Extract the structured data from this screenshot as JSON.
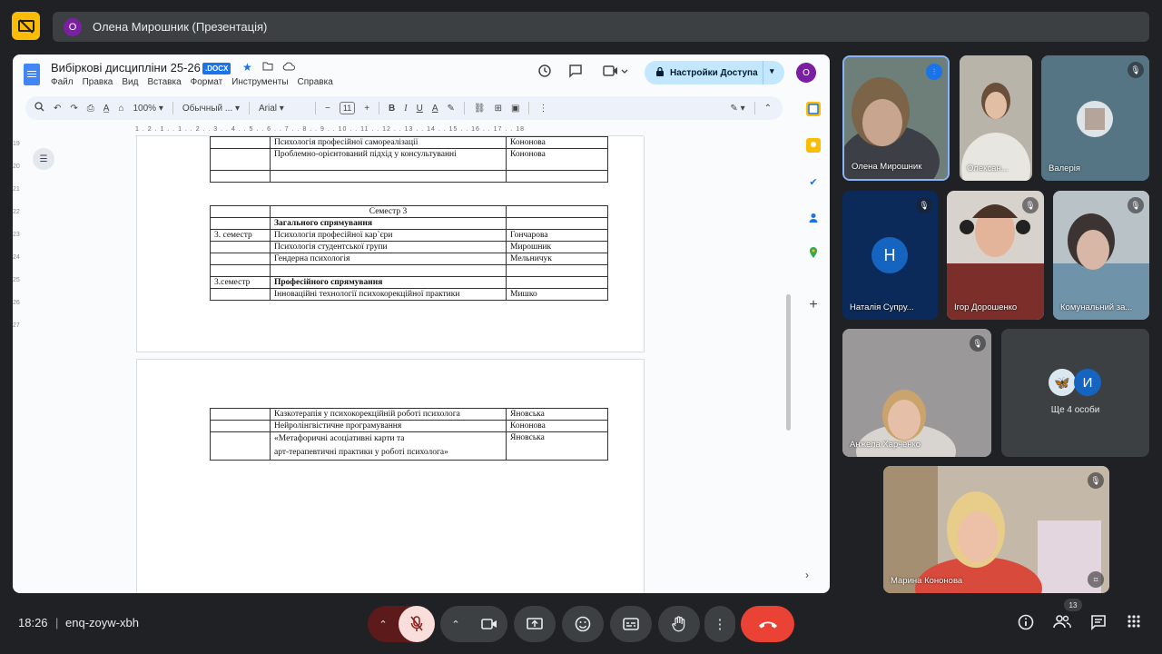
{
  "presentation": {
    "avatar_letter": "О",
    "title": "Олена Мирошник (Презентація)"
  },
  "docs": {
    "title": "Вибіркові дисципліни 25-26",
    "ext_badge": ".DOCX",
    "menu": [
      "Файл",
      "Правка",
      "Вид",
      "Вставка",
      "Формат",
      "Инструменты",
      "Справка"
    ],
    "access_button": "Настройки Доступа",
    "user_avatar": "О",
    "toolbar": {
      "zoom": "100%",
      "style": "Обычный ...",
      "font": "Arial",
      "size": "11",
      "bold": "B",
      "italic": "I",
      "underline": "U",
      "text_color": "A"
    },
    "ruler": "1 . 2 . 1 . . 1 . . 2 . . 3 . . 4 . . 5 . . 6 . . 7 . . 8 . . 9 . . 10 . . 11 . . 12 . . 13 . . 14 . . 15 . . 16 . . 17 . . 18",
    "vruler": [
      "19",
      "20",
      "21",
      "22",
      "23",
      "24",
      "25",
      "26",
      "27"
    ],
    "table1": [
      [
        "",
        "Психологія  професійної самореалізації",
        "Кононова"
      ],
      [
        "",
        "Проблемно-орієнтований підхід у консультуванні",
        "Кононова"
      ],
      [
        "",
        "",
        ""
      ]
    ],
    "table2": {
      "header": "Семестр 3",
      "rows": [
        [
          "",
          "Загального спрямування",
          ""
        ],
        [
          "3. семестр",
          "Психологія професійної кар`єри",
          "Гончарова"
        ],
        [
          "",
          "Психологія студентської групи",
          "Мирошник"
        ],
        [
          "",
          "Гендерна психологія",
          "Мельничук"
        ],
        [
          "",
          "",
          ""
        ],
        [
          "3.семестр",
          "Професійного спрямування",
          ""
        ],
        [
          "",
          "Інноваційні технології психокорекційної практики",
          "Мишко"
        ]
      ]
    },
    "table3": [
      [
        "",
        "Казкотерапія у психокорекційній роботі психолога",
        "Яновська"
      ],
      [
        "",
        "Нейролінгвістичне програмування",
        "Кононова"
      ],
      [
        "",
        "«Метафоричні асоціативні карти та",
        "Яновська"
      ],
      [
        "",
        "арт-терапевтичні практики у роботі психолога»",
        ""
      ]
    ]
  },
  "participants": [
    {
      "name": "Олена Мирошник",
      "speaking": true
    },
    {
      "name": "Олексан...",
      "speaking": false
    },
    {
      "name": "Валерія",
      "muted": true
    },
    {
      "name": "Наталія Супру...",
      "avatar": "Н",
      "muted": true
    },
    {
      "name": "Ігор Дорошенко",
      "muted": true
    },
    {
      "name": "Комунальний за...",
      "muted": true
    },
    {
      "name": "Анжела Харченко",
      "muted": true
    },
    {
      "name": "Марина Кононова",
      "muted": true
    }
  ],
  "more_people": {
    "avatar": "И",
    "label": "Ще 4 особи"
  },
  "bottom": {
    "time": "18:26",
    "separator": "|",
    "meeting_code": "enq-zoyw-xbh",
    "people_count": "13"
  }
}
